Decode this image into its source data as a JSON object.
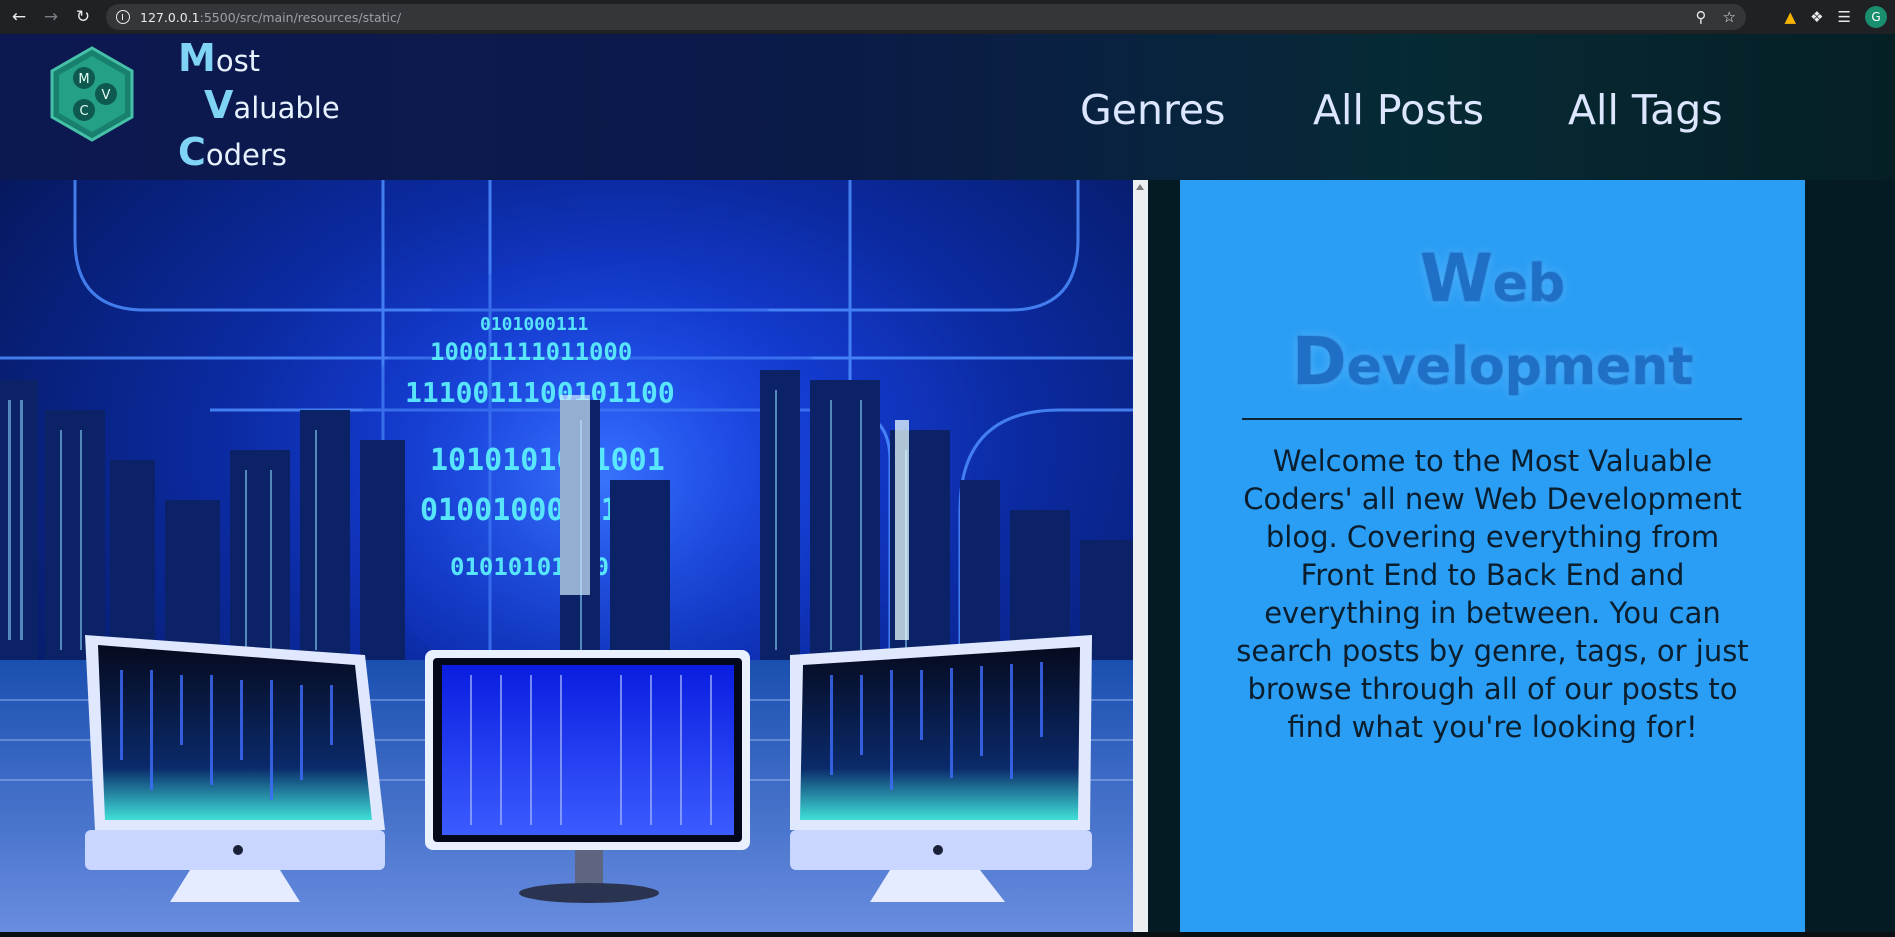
{
  "browser": {
    "url_host": "127.0.0.1",
    "url_path": ":5500/src/main/resources/static/",
    "profile_initial": "G"
  },
  "brand": {
    "line1_cap": "M",
    "line1_rest": "ost",
    "line2_cap": "V",
    "line2_rest": "aluable",
    "line3_cap": "C",
    "line3_rest": "oders",
    "logo_letters": [
      "M",
      "C",
      "V"
    ]
  },
  "nav": {
    "genres": "Genres",
    "all_posts": "All Posts",
    "all_tags": "All Tags"
  },
  "card": {
    "title_line1_cap": "W",
    "title_line1_rest": "eb",
    "title_line2_cap": "D",
    "title_line2_rest": "evelopment",
    "intro": "Welcome to the Most Valuable Coders' all new Web Development blog. Covering everything from Front End to Back End and everything in between. You can search posts by genre, tags, or just browse through all of our posts to find what you're looking for!"
  },
  "hero": {
    "binary": [
      "0101000111",
      "10001111011000",
      "1110011100101100",
      "1010101011001",
      "0100100001111",
      "010101010100110"
    ]
  },
  "colors": {
    "header_bg": "#0b1b48",
    "card_bg": "#2a9df4",
    "brand_accent": "#7fd3f5",
    "nav_text": "#dce6ff"
  }
}
